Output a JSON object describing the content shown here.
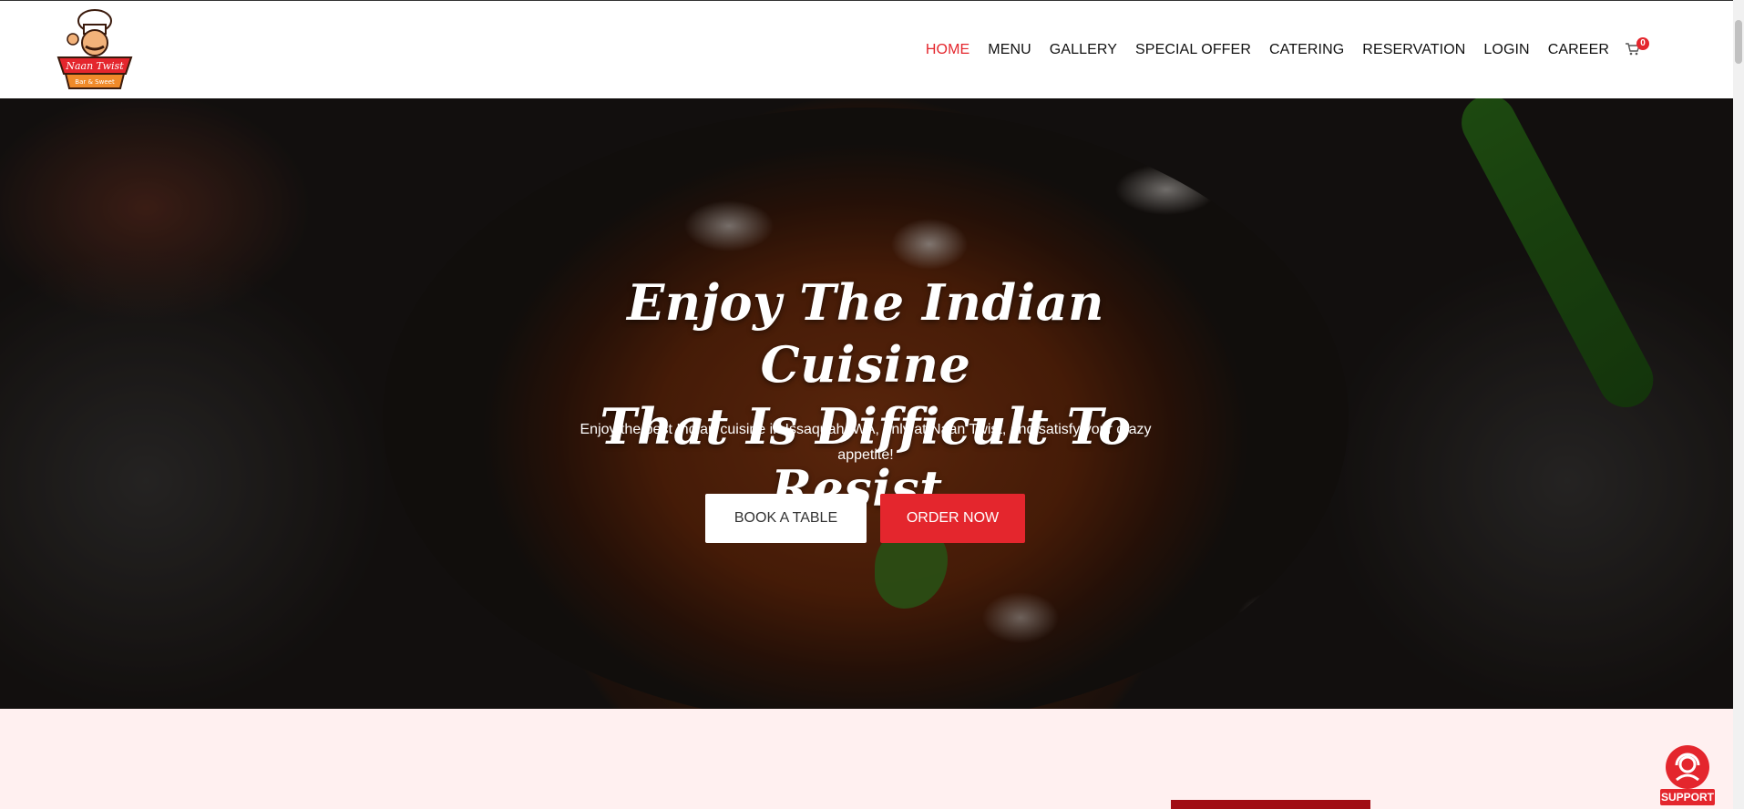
{
  "header": {
    "logo_text": "Naan Twist Restaurant Bar & Sweet",
    "nav": [
      {
        "label": "HOME",
        "active": true
      },
      {
        "label": "MENU"
      },
      {
        "label": "GALLERY"
      },
      {
        "label": "SPECIAL OFFER"
      },
      {
        "label": "CATERING"
      },
      {
        "label": "RESERVATION"
      },
      {
        "label": "LOGIN"
      },
      {
        "label": "CAREER"
      }
    ],
    "cart_count": "0",
    "cart_icon": "cart-icon"
  },
  "hero": {
    "title_line1": "Enjoy The Indian Cuisine",
    "title_line2": "That Is Difficult To Resist.",
    "subtitle": "Enjoy the best Indian cuisine in Issaquah, WA, only at Naan Twist, and satisfy your crazy appetite!",
    "book_button": "BOOK A TABLE",
    "order_button": "ORDER NOW"
  },
  "support": {
    "label": "SUPPORT",
    "icon": "support-agent-icon"
  },
  "colors": {
    "accent": "#e4262d",
    "dark_red": "#a10d14",
    "light_bg": "#fff0f0"
  }
}
